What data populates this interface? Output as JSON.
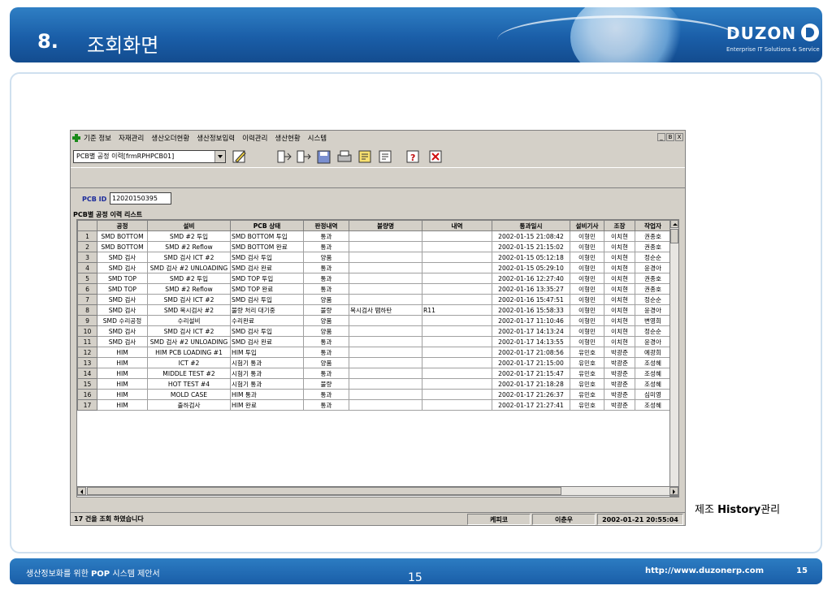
{
  "header": {
    "number": "8.",
    "title": "조회화면"
  },
  "logo": {
    "name": "DUZON",
    "tagline": "Enterprise IT Solutions & Service"
  },
  "app": {
    "menus": [
      "기준 정보",
      "자재관리",
      "생산오더현황",
      "생산정보입력",
      "이력관리",
      "생산현황",
      "시스템"
    ],
    "window_controls": [
      "_",
      "B",
      "X"
    ],
    "form_select": "PCB별 공정 이력[frmRPHPCB01]",
    "pcb_id_label": "PCB ID",
    "pcb_id_value": "12020150395",
    "list_title": "PCB별 공정 이력 리스트",
    "columns": [
      "",
      "공정",
      "설비",
      "PCB 상태",
      "판정내역",
      "불량명",
      "내역",
      "통과일시",
      "설비기사",
      "조장",
      "작업자"
    ],
    "rows": [
      [
        "1",
        "SMD BOTTOM",
        "SMD #2 투입",
        "SMD BOTTOM 투입",
        "통과",
        "",
        "",
        "2002-01-15 21:08:42",
        "이형민",
        "이치현",
        "권종호"
      ],
      [
        "2",
        "SMD BOTTOM",
        "SMD #2 Reflow",
        "SMD BOTTOM 완료",
        "통과",
        "",
        "",
        "2002-01-15 21:15:02",
        "이형민",
        "이치현",
        "권종호"
      ],
      [
        "3",
        "SMD 검사",
        "SMD 검사 ICT #2",
        "SMD 검사 투입",
        "양품",
        "",
        "",
        "2002-01-15 05:12:18",
        "이형민",
        "이치현",
        "정순순"
      ],
      [
        "4",
        "SMD 검사",
        "SMD 검사 #2 UNLOADING",
        "SMD 검사 완료",
        "통과",
        "",
        "",
        "2002-01-15 05:29:10",
        "이형민",
        "이치현",
        "윤경아"
      ],
      [
        "5",
        "SMD TOP",
        "SMD #2 투입",
        "SMD TOP 투입",
        "통과",
        "",
        "",
        "2002-01-16 12:27:40",
        "이형민",
        "이치현",
        "권종호"
      ],
      [
        "6",
        "SMD TOP",
        "SMD #2 Reflow",
        "SMD TOP 완료",
        "통과",
        "",
        "",
        "2002-01-16 13:35:27",
        "이형민",
        "이치현",
        "권종호"
      ],
      [
        "7",
        "SMD 검사",
        "SMD 검사 ICT #2",
        "SMD 검사 투입",
        "양품",
        "",
        "",
        "2002-01-16 15:47:51",
        "이형민",
        "이치현",
        "정순순"
      ],
      [
        "8",
        "SMD 검사",
        "SMD 목시검사 #2",
        "불량 처리 대기중",
        "불량",
        "목시검사 땜하탄",
        "R11",
        "2002-01-16 15:58:33",
        "이형민",
        "이치현",
        "윤경아"
      ],
      [
        "9",
        "SMD 수리공정",
        "수리설비",
        "수리완료",
        "양품",
        "",
        "",
        "2002-01-17 11:10:46",
        "이형민",
        "이치현",
        "변영희"
      ],
      [
        "10",
        "SMD 검사",
        "SMD 검사 ICT #2",
        "SMD 검사 투입",
        "양품",
        "",
        "",
        "2002-01-17 14:13:24",
        "이형민",
        "이치현",
        "정순순"
      ],
      [
        "11",
        "SMD 검사",
        "SMD 검사 #2 UNLOADING",
        "SMD 검사 완료",
        "통과",
        "",
        "",
        "2002-01-17 14:13:55",
        "이형민",
        "이치현",
        "윤경아"
      ],
      [
        "12",
        "HIM",
        "HIM PCB LOADING #1",
        "HIM 투입",
        "통과",
        "",
        "",
        "2002-01-17 21:08:56",
        "유민호",
        "박광준",
        "예광희"
      ],
      [
        "13",
        "HIM",
        "ICT #2",
        "시험기 통과",
        "양품",
        "",
        "",
        "2002-01-17 21:15:00",
        "유민호",
        "박광준",
        "조성혜"
      ],
      [
        "14",
        "HIM",
        "MIDDLE TEST #2",
        "시험기 통과",
        "통과",
        "",
        "",
        "2002-01-17 21:15:47",
        "유민호",
        "박광준",
        "조성혜"
      ],
      [
        "15",
        "HIM",
        "HOT TEST #4",
        "시험기 통과",
        "불량",
        "",
        "",
        "2002-01-17 21:18:28",
        "유민호",
        "박광준",
        "조성혜"
      ],
      [
        "16",
        "HIM",
        "MOLD CASE",
        "HIM 통과",
        "통과",
        "",
        "",
        "2002-01-17 21:26:37",
        "유민호",
        "박광준",
        "심미영"
      ],
      [
        "17",
        "HIM",
        "출하검사",
        "HIM 완료",
        "통과",
        "",
        "",
        "2002-01-17 21:27:41",
        "유민호",
        "박광준",
        "조성혜"
      ]
    ],
    "status": {
      "message": "17 건을 조회 하였습니다",
      "company": "케피코",
      "user": "이춘우",
      "datetime": "2002-01-21 20:55:04"
    }
  },
  "caption": {
    "prefix": "제조 ",
    "bold": "History",
    "suffix": "관리"
  },
  "footer": {
    "left_prefix": "생산정보화를 위한 ",
    "left_bold": "POP",
    "left_suffix": " 시스템 제안서",
    "page_center": "15",
    "url": "http://www.duzonerp.com",
    "page_right": "15"
  },
  "colors": {
    "brand_blue": "#1a5ea8",
    "label_blue": "#1a2a9a",
    "window_gray": "#d4d0c8"
  },
  "toolbar_icons": [
    "edit-icon",
    "import-icon",
    "export-icon",
    "save-icon",
    "print-icon",
    "notice-icon",
    "memo-icon",
    "help-icon",
    "close-icon"
  ]
}
